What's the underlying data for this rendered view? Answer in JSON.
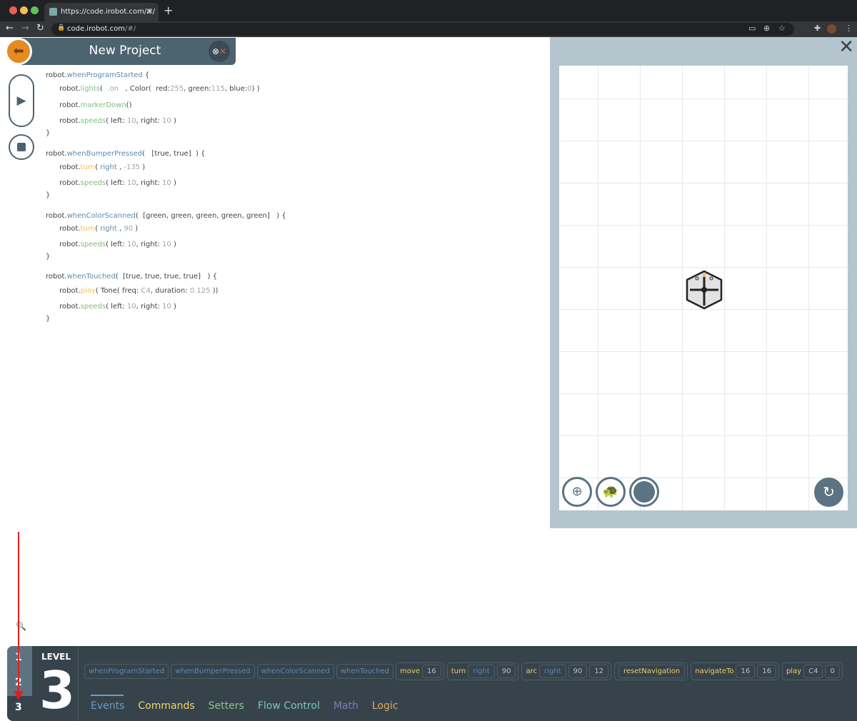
{
  "browser": {
    "tab_title": "https://code.irobot.com/#/",
    "url_host": "code.irobot.com",
    "url_path": "/#/"
  },
  "header": {
    "title": "New Project"
  },
  "code": [
    [
      [
        "t-obj",
        "robot."
      ],
      [
        "t-ev",
        "whenProgramStarted"
      ],
      [
        "t-pl",
        " {"
      ]
    ],
    [
      [
        "t-obj",
        "      robot."
      ],
      [
        "t-fn",
        "lights"
      ],
      [
        "t-pl",
        "(  "
      ],
      [
        "t-num",
        ".on"
      ],
      [
        "t-pl",
        "   , Color(  red:"
      ],
      [
        "t-num",
        "255"
      ],
      [
        "t-pl",
        ", green:"
      ],
      [
        "t-num",
        "115"
      ],
      [
        "t-pl",
        ", blue:"
      ],
      [
        "t-num",
        "0"
      ],
      [
        "t-pl",
        ") )"
      ]
    ],
    [
      [
        "t-obj",
        "      robot."
      ],
      [
        "t-fn",
        "markerDown"
      ],
      [
        "t-pl",
        "()"
      ]
    ],
    [
      [
        "t-obj",
        "      robot."
      ],
      [
        "t-fn",
        "speeds"
      ],
      [
        "t-pl",
        "( left: "
      ],
      [
        "t-num",
        "10"
      ],
      [
        "t-pl",
        ", right: "
      ],
      [
        "t-num",
        "10"
      ],
      [
        "t-pl",
        " )"
      ]
    ],
    [
      [
        "t-pl",
        "}"
      ]
    ],
    [
      [
        "t-obj",
        "robot."
      ],
      [
        "t-ev",
        "whenBumperPressed"
      ],
      [
        "t-pl",
        "(   [true, true]  ) {"
      ]
    ],
    [
      [
        "t-obj",
        "      robot."
      ],
      [
        "t-cmd",
        "turn"
      ],
      [
        "t-pl",
        "( "
      ],
      [
        "t-dir",
        "right"
      ],
      [
        "t-pl",
        " , "
      ],
      [
        "t-num",
        "-135"
      ],
      [
        "t-pl",
        " )"
      ]
    ],
    [
      [
        "t-obj",
        "      robot."
      ],
      [
        "t-fn",
        "speeds"
      ],
      [
        "t-pl",
        "( left: "
      ],
      [
        "t-num",
        "10"
      ],
      [
        "t-pl",
        ", right: "
      ],
      [
        "t-num",
        "10"
      ],
      [
        "t-pl",
        " )"
      ]
    ],
    [
      [
        "t-pl",
        "}"
      ]
    ],
    [
      [
        "t-obj",
        "robot."
      ],
      [
        "t-ev",
        "whenColorScanned"
      ],
      [
        "t-pl",
        "(  [green, green, green, green, green]   ) {"
      ]
    ],
    [
      [
        "t-obj",
        "      robot."
      ],
      [
        "t-cmd",
        "turn"
      ],
      [
        "t-pl",
        "( "
      ],
      [
        "t-dir",
        "right"
      ],
      [
        "t-pl",
        " , "
      ],
      [
        "t-num",
        "90"
      ],
      [
        "t-pl",
        " )"
      ]
    ],
    [
      [
        "t-obj",
        "      robot."
      ],
      [
        "t-fn",
        "speeds"
      ],
      [
        "t-pl",
        "( left: "
      ],
      [
        "t-num",
        "10"
      ],
      [
        "t-pl",
        ", right: "
      ],
      [
        "t-num",
        "10"
      ],
      [
        "t-pl",
        " )"
      ]
    ],
    [
      [
        "t-pl",
        "}"
      ]
    ],
    [
      [
        "t-obj",
        "robot."
      ],
      [
        "t-ev",
        "whenTouched"
      ],
      [
        "t-pl",
        "(  [true, true, true, true]   ) {"
      ]
    ],
    [
      [
        "t-obj",
        "      robot."
      ],
      [
        "t-cmd",
        "play"
      ],
      [
        "t-pl",
        "( Tone( freq: "
      ],
      [
        "t-num",
        "C4"
      ],
      [
        "t-pl",
        ", duration: "
      ],
      [
        "t-num",
        "0.125"
      ],
      [
        "t-pl",
        " ))"
      ]
    ],
    [
      [
        "t-obj",
        "      robot."
      ],
      [
        "t-fn",
        "speeds"
      ],
      [
        "t-pl",
        "( left: "
      ],
      [
        "t-num",
        "10"
      ],
      [
        "t-pl",
        ", right: "
      ],
      [
        "t-num",
        "10"
      ],
      [
        "t-pl",
        " )"
      ]
    ],
    [
      [
        "t-pl",
        "}"
      ]
    ]
  ],
  "level": {
    "label": "LEVEL",
    "current": "3",
    "options": [
      "1",
      "2",
      "3"
    ]
  },
  "events": [
    "whenProgramStarted",
    "whenBumperPressed",
    "whenColorScanned",
    "whenTouched"
  ],
  "commands": [
    {
      "name": "move",
      "args": [
        {
          "v": "16"
        }
      ]
    },
    {
      "name": "turn",
      "args": [
        {
          "v": "right",
          "dir": true
        },
        {
          "v": "90"
        }
      ]
    },
    {
      "name": "arc",
      "args": [
        {
          "v": "right",
          "dir": true
        },
        {
          "v": "90"
        },
        {
          "v": "12"
        }
      ]
    },
    {
      "name": "resetNavigation",
      "args": []
    },
    {
      "name": "navigateTo",
      "args": [
        {
          "v": "16"
        },
        {
          "v": "16"
        }
      ]
    },
    {
      "name": "play",
      "args": [
        {
          "v": "C4"
        },
        {
          "v": "0"
        }
      ]
    }
  ],
  "categories": [
    {
      "label": "Events",
      "color": "#6a9cc4"
    },
    {
      "label": "Commands",
      "color": "#f0d56a"
    },
    {
      "label": "Setters",
      "color": "#8cc48c"
    },
    {
      "label": "Flow Control",
      "color": "#7fc4b4"
    },
    {
      "label": "Math",
      "color": "#7d7fb8"
    },
    {
      "label": "Logic",
      "color": "#e8a860"
    }
  ],
  "colors": {
    "accent": "#e58b22",
    "header": "#4c6370",
    "bottom_bar": "#36434b"
  }
}
